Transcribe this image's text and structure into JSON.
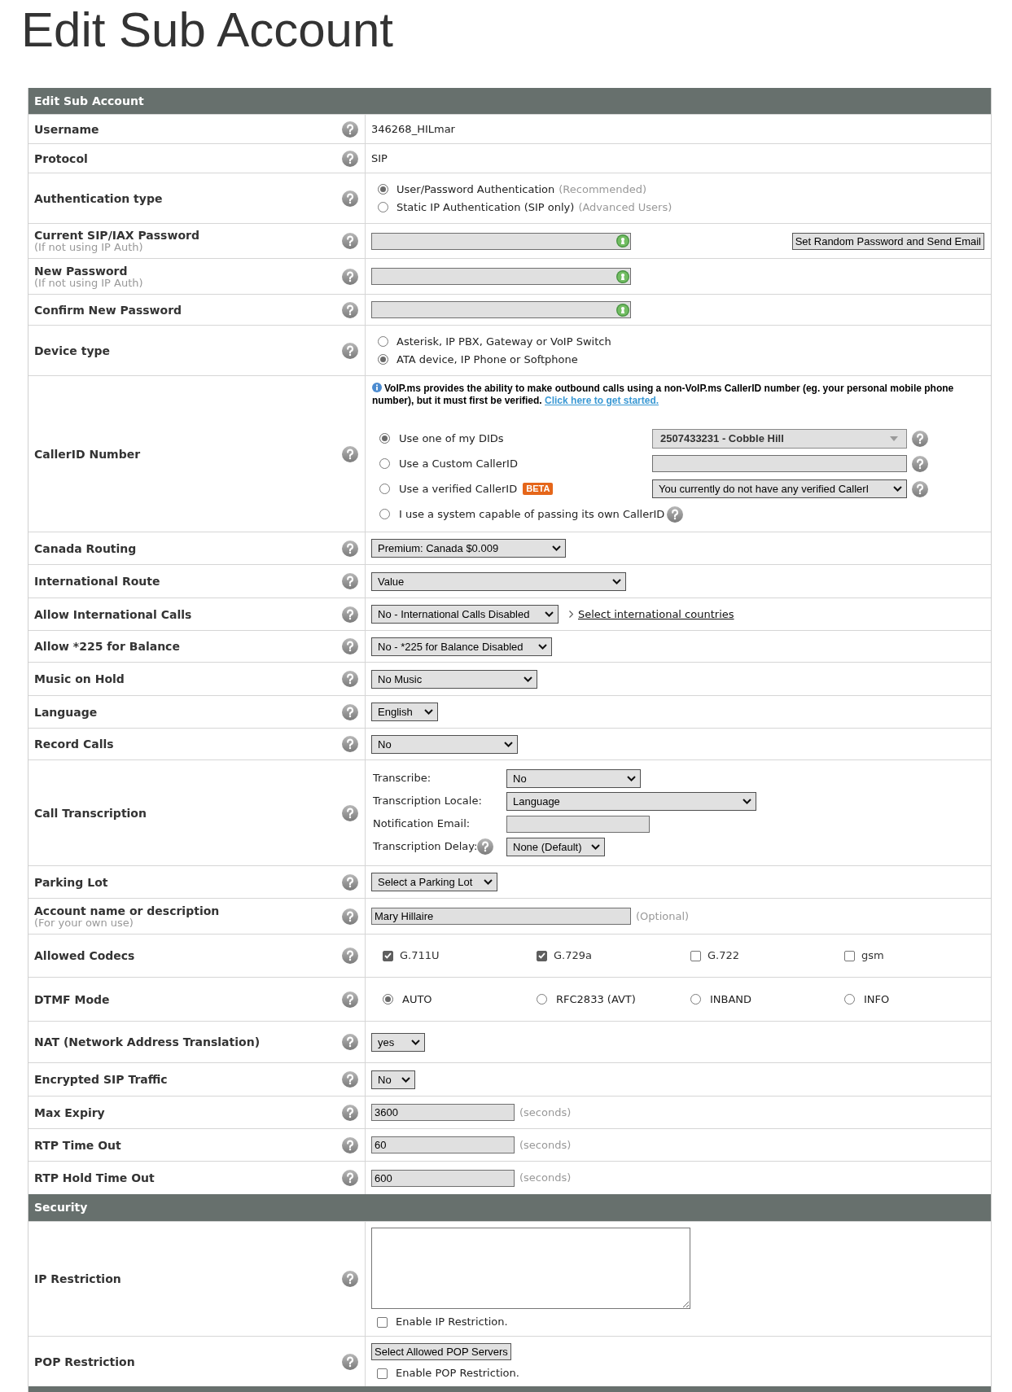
{
  "page": {
    "title": "Edit Sub Account"
  },
  "sections": [
    {
      "title": "Edit Sub Account",
      "rows": [
        {
          "kind": "text",
          "label": "Username",
          "value": "346268_HILmar"
        },
        {
          "kind": "text",
          "label": "Protocol",
          "value": "SIP"
        },
        {
          "kind": "radio_list",
          "label": "Authentication type",
          "options": [
            {
              "label": "User/Password Authentication",
              "note": "(Recommended)",
              "selected": true
            },
            {
              "label": "Static IP Authentication (SIP only)",
              "note": "(Advanced Users)",
              "selected": false
            }
          ]
        },
        {
          "kind": "password",
          "label": "Current SIP/IAX Password",
          "sublabel": "(If not using IP Auth)",
          "button": "Set Random Password and Send Email"
        },
        {
          "kind": "password",
          "label": "New Password",
          "sublabel": "(If not using IP Auth)"
        },
        {
          "kind": "password",
          "label": "Confirm New Password"
        },
        {
          "kind": "radio_list",
          "label": "Device type",
          "options": [
            {
              "label": "Asterisk, IP PBX, Gateway or VoIP Switch",
              "selected": false
            },
            {
              "label": "ATA device, IP Phone or Softphone",
              "selected": true
            }
          ]
        },
        {
          "kind": "callerid",
          "label": "CallerID Number",
          "notice": "VoIP.ms provides the ability to make outbound calls using a non-VoIP.ms CallerID number (eg. your personal mobile phone number), but it must first be verified.",
          "notice_link": "Click here to get started.",
          "options": [
            {
              "label": "Use one of my DIDs",
              "selected": true,
              "control": {
                "kind": "combo",
                "value": "2507433231 - Cobble Hill"
              }
            },
            {
              "label": "Use a Custom CallerID",
              "selected": false,
              "control": {
                "kind": "input"
              }
            },
            {
              "label": "Use a verified CallerID",
              "badge": "BETA",
              "selected": false,
              "control": {
                "kind": "select",
                "value": "You currently do not have any verified CallerI"
              }
            },
            {
              "label": "I use a system capable of passing its own CallerID",
              "selected": false
            }
          ]
        },
        {
          "kind": "select",
          "label": "Canada Routing",
          "value": "Premium: Canada $0.009"
        },
        {
          "kind": "select",
          "label": "International Route",
          "value": "Value"
        },
        {
          "kind": "select",
          "label": "Allow International Calls",
          "value": "No - International Calls Disabled",
          "link": "Select international countries"
        },
        {
          "kind": "select",
          "label": "Allow *225 for Balance",
          "value": "No - *225 for Balance Disabled"
        },
        {
          "kind": "select",
          "label": "Music on Hold",
          "value": "No Music"
        },
        {
          "kind": "select",
          "label": "Language",
          "value": "English"
        },
        {
          "kind": "select",
          "label": "Record Calls",
          "value": "No"
        },
        {
          "kind": "transcription",
          "label": "Call Transcription",
          "fields": [
            {
              "kind": "select",
              "label": "Transcribe:",
              "value": "No",
              "help": false
            },
            {
              "kind": "select",
              "label": "Transcription Locale:",
              "value": "Language",
              "help": false
            },
            {
              "kind": "input",
              "label": "Notification Email:",
              "help": false
            },
            {
              "kind": "select",
              "label": "Transcription Delay:",
              "value": "None (Default)",
              "help": true
            }
          ]
        },
        {
          "kind": "select",
          "label": "Parking Lot",
          "value": "Select a Parking Lot"
        },
        {
          "kind": "input",
          "label": "Account name or description",
          "sublabel": "(For your own use)",
          "value": "Mary Hillaire",
          "hint": "(Optional)"
        },
        {
          "kind": "checkbox_row",
          "label": "Allowed Codecs",
          "options": [
            {
              "label": "G.711U",
              "checked": true
            },
            {
              "label": "G.729a",
              "checked": true
            },
            {
              "label": "G.722",
              "checked": false
            },
            {
              "label": "gsm",
              "checked": false
            }
          ]
        },
        {
          "kind": "radio_row",
          "label": "DTMF Mode",
          "options": [
            {
              "label": "AUTO",
              "selected": true
            },
            {
              "label": "RFC2833 (AVT)",
              "selected": false
            },
            {
              "label": "INBAND",
              "selected": false
            },
            {
              "label": "INFO",
              "selected": false
            }
          ]
        },
        {
          "kind": "select",
          "label": "NAT (Network Address Translation)",
          "value": "yes"
        },
        {
          "kind": "select",
          "label": "Encrypted SIP Traffic",
          "value": "No"
        },
        {
          "kind": "input",
          "label": "Max Expiry",
          "value": "3600",
          "hint": "(seconds)"
        },
        {
          "kind": "input",
          "label": "RTP Time Out",
          "value": "60",
          "hint": "(seconds)"
        },
        {
          "kind": "input",
          "label": "RTP Hold Time Out",
          "value": "600",
          "hint": "(seconds)"
        }
      ]
    },
    {
      "title": "Security",
      "rows": [
        {
          "kind": "textarea",
          "label": "IP Restriction",
          "checkbox": {
            "label": "Enable IP Restriction.",
            "checked": false
          }
        },
        {
          "kind": "button",
          "label": "POP Restriction",
          "button": "Select Allowed POP Servers",
          "checkbox": {
            "label": "Enable POP Restriction.",
            "checked": false
          }
        }
      ]
    }
  ]
}
